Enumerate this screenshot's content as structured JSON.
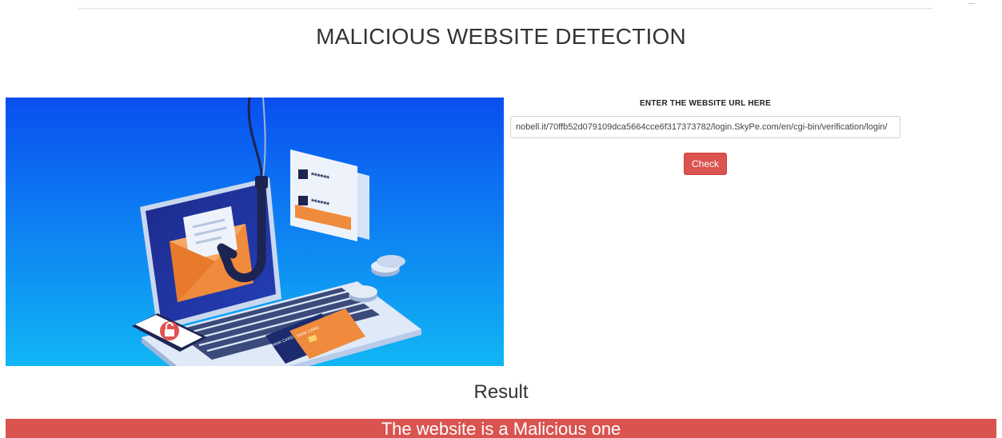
{
  "header": {
    "title": "MALICIOUS WEBSITE DETECTION"
  },
  "form": {
    "label": "ENTER THE WEBSITE URL HERE",
    "url_value": "nobell.it/70ffb52d079109dca5664cce6f317373782/login.SkyPe.com/en/cgi-bin/verification/login/",
    "button_label": "Check"
  },
  "illustration": {
    "card_1_text": "BANK CARD",
    "card_2_text": "BANK CARD",
    "password_mask": "******"
  },
  "result": {
    "title": "Result",
    "message": "The website is a Malicious one"
  },
  "colors": {
    "danger": "#d9534f",
    "hero_gradient_top": "#0a4ff0",
    "hero_gradient_bottom": "#11b6f5"
  }
}
